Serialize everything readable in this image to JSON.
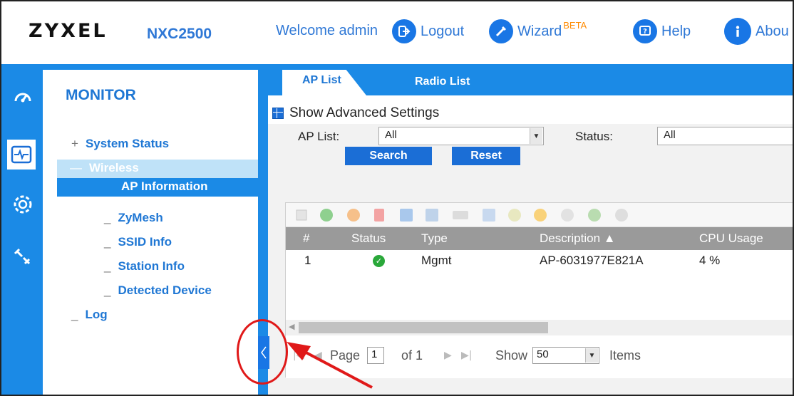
{
  "header": {
    "logo": "ZYXEL",
    "model": "NXC2500",
    "welcome": "Welcome admin",
    "logout": "Logout",
    "wizard": "Wizard",
    "beta": "BETA",
    "help": "Help",
    "about": "Abou"
  },
  "sidebar": {
    "icons": [
      "dashboard-icon",
      "monitor-icon",
      "settings-icon",
      "maintenance-icon"
    ],
    "title": "MONITOR",
    "items": [
      {
        "prefix": "+",
        "label": "System Status"
      },
      {
        "prefix": "—",
        "label": "Wireless"
      },
      {
        "prefix": "",
        "label": "AP Information"
      },
      {
        "prefix": "_",
        "label": "ZyMesh"
      },
      {
        "prefix": "_",
        "label": "SSID Info"
      },
      {
        "prefix": "_",
        "label": "Station Info"
      },
      {
        "prefix": "_",
        "label": "Detected Device"
      },
      {
        "prefix": "_",
        "label": "Log"
      }
    ]
  },
  "tabs": [
    "AP List",
    "Radio List"
  ],
  "advanced": "Show Advanced Settings",
  "filters": {
    "ap_list_label": "AP List:",
    "ap_list_value": "All",
    "status_label": "Status:",
    "status_value": "All",
    "search": "Search",
    "reset": "Reset"
  },
  "table": {
    "columns": [
      "#",
      "Status",
      "Type",
      "Description ▲",
      "CPU Usage"
    ],
    "rows": [
      {
        "num": "1",
        "status": "ok",
        "type": "Mgmt",
        "description": "AP-6031977E821A",
        "cpu": "4 %"
      }
    ]
  },
  "pager": {
    "page_label": "Page",
    "page_value": "1",
    "of": "of 1",
    "show_label": "Show",
    "show_value": "50",
    "items_label": "Items"
  },
  "colors": {
    "accent": "#1b8ae6",
    "brand_text": "#2f78d6",
    "annotation": "#e01919"
  }
}
